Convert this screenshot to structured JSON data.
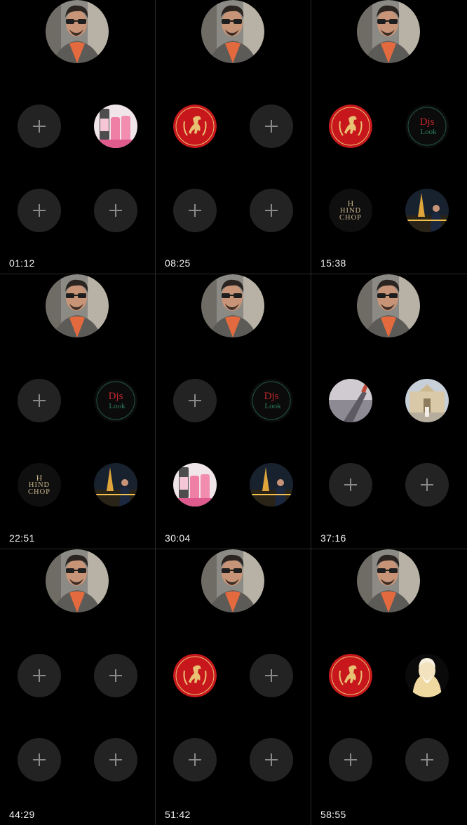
{
  "cells": [
    {
      "time": "01:12",
      "slots": [
        "plus",
        "beauty-products",
        "plus",
        "plus"
      ]
    },
    {
      "time": "08:25",
      "slots": [
        "horse-logo",
        "plus",
        "plus",
        "plus"
      ]
    },
    {
      "time": "15:38",
      "slots": [
        "horse-logo",
        "djs-look-logo",
        "hind-chop-logo",
        "eiffel-photo"
      ]
    },
    {
      "time": "22:51",
      "slots": [
        "plus",
        "djs-look-logo",
        "hind-chop-logo",
        "eiffel-photo"
      ]
    },
    {
      "time": "30:04",
      "slots": [
        "plus",
        "djs-look-logo",
        "beauty-products",
        "eiffel-photo"
      ]
    },
    {
      "time": "37:16",
      "slots": [
        "airplane-wing-photo",
        "palace-photo",
        "plus",
        "plus"
      ]
    },
    {
      "time": "44:29",
      "slots": [
        "plus",
        "plus",
        "plus",
        "plus"
      ]
    },
    {
      "time": "51:42",
      "slots": [
        "horse-logo",
        "plus",
        "plus",
        "plus"
      ]
    },
    {
      "time": "58:55",
      "slots": [
        "horse-logo",
        "elder-portrait",
        "plus",
        "plus"
      ]
    }
  ],
  "logos": {
    "hind_chop": {
      "mark": "H",
      "line1": "HIND",
      "line2": "CHOP"
    },
    "djs_look": {
      "line1": "Djs",
      "line2": "Look"
    }
  },
  "colors": {
    "background": "#000000",
    "plus_circle": "#232323",
    "plus_sign": "#8a8a8a",
    "horse_red": "#c8171c",
    "horse_gold": "#e8c073"
  }
}
